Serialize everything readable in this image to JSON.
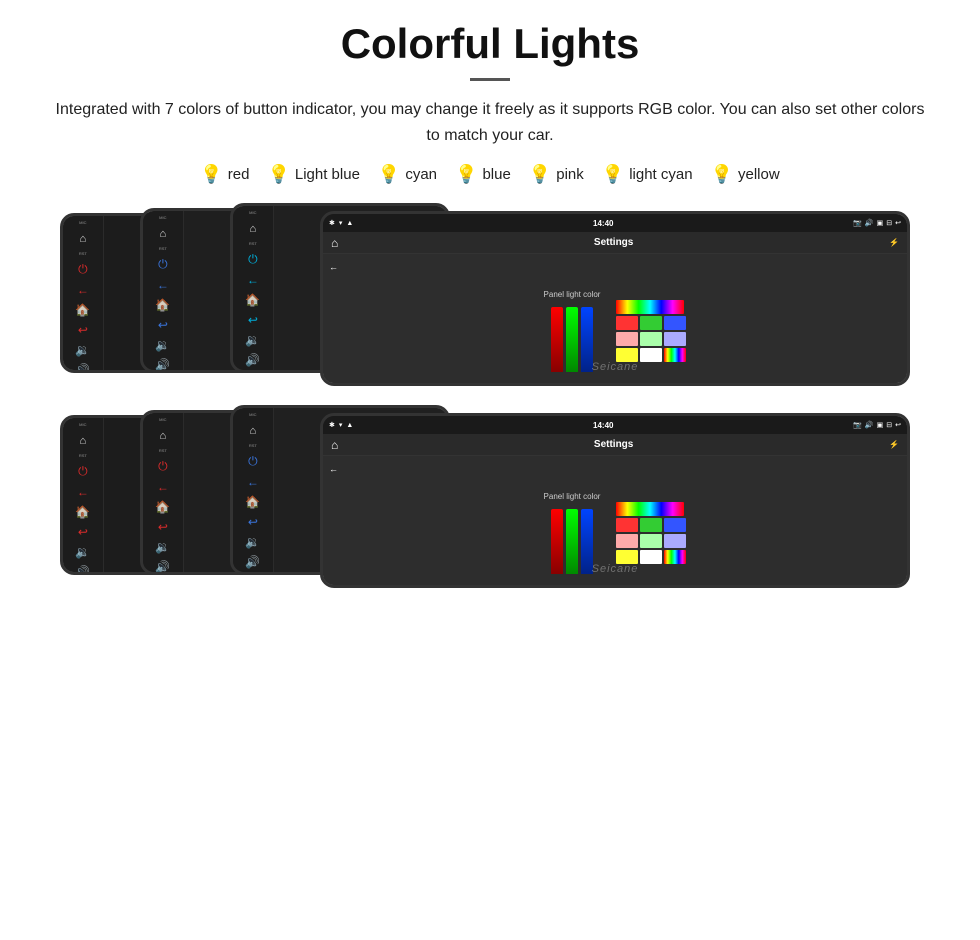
{
  "title": "Colorful Lights",
  "description": "Integrated with 7 colors of button indicator, you may change it freely as it supports RGB color. You can also set other colors to match your car.",
  "colors": [
    {
      "name": "red",
      "color": "#ff2222",
      "bulb": "🔴"
    },
    {
      "name": "Light blue",
      "color": "#88aaff",
      "bulb": "🔵"
    },
    {
      "name": "cyan",
      "color": "#00ddff",
      "bulb": "🔵"
    },
    {
      "name": "blue",
      "color": "#2244ff",
      "bulb": "🔵"
    },
    {
      "name": "pink",
      "color": "#ff66bb",
      "bulb": "🔴"
    },
    {
      "name": "light cyan",
      "color": "#aaeeff",
      "bulb": "🔵"
    },
    {
      "name": "yellow",
      "color": "#ffee00",
      "bulb": "🟡"
    }
  ],
  "device": {
    "nav_title": "Settings",
    "panel_label": "Panel light color",
    "time": "14:40",
    "watermark": "Seicane"
  },
  "swatches": {
    "row1": [
      "#ff3333",
      "#33cc33",
      "#3355ff"
    ],
    "row2": [
      "#ffaaaa",
      "#aaffaa",
      "#aaaaff"
    ],
    "row3": [
      "#ffff33",
      "#ffffff",
      "rainbow"
    ]
  }
}
